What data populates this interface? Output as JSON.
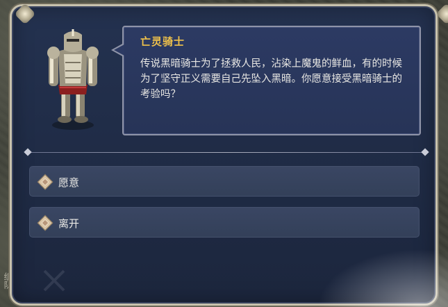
{
  "hud": {
    "side_label": "组队"
  },
  "dialog": {
    "speaker": "亡灵骑士",
    "text": "传说黑暗骑士为了拯救人民，沾染上魔鬼的鲜血，有的时候为了坚守正义需要自己先坠入黑暗。你愿意接受黑暗骑士的考验吗？",
    "portrait": "undead-knight-portrait",
    "options": [
      {
        "label": "愿意",
        "icon": "diamond-icon"
      },
      {
        "label": "离开",
        "icon": "diamond-icon"
      }
    ]
  },
  "colors": {
    "panel_bg": "#1f2b45",
    "speech_bg": "#2c3a63",
    "name_gold": "#f0c24a",
    "option_bg": "#3a4663",
    "frame": "#c8c2ad"
  }
}
